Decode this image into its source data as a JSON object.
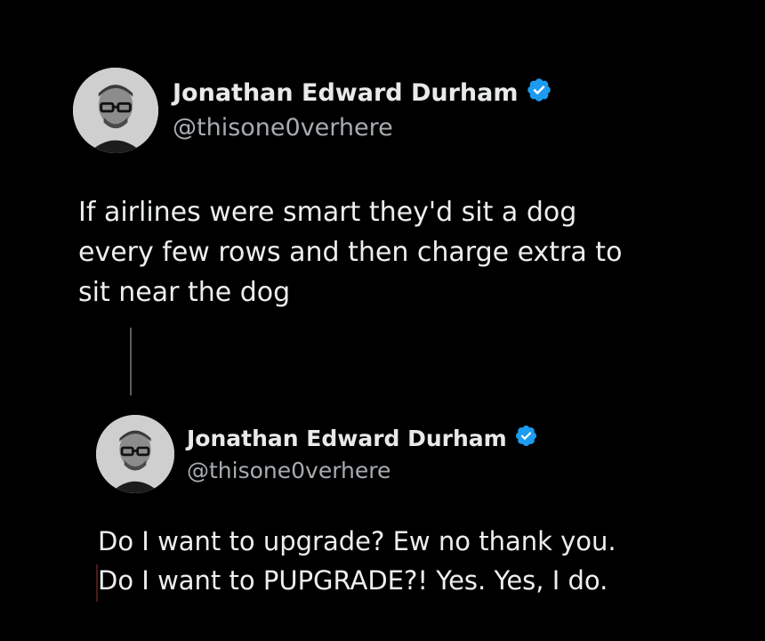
{
  "colors": {
    "background": "#000000",
    "text": "#e7e9ea",
    "handle": "#a7acb0",
    "verified_badge": "#1d9bf0",
    "thread_line": "#5a5e62"
  },
  "tweets": [
    {
      "author": {
        "display_name": "Jonathan Edward Durham",
        "handle": "@thisone0verhere",
        "verified": true,
        "avatar_icon": "profile-photo"
      },
      "text": "If airlines were smart they'd sit a dog\nevery few rows and then charge extra to\nsit near the dog"
    },
    {
      "author": {
        "display_name": "Jonathan Edward Durham",
        "handle": "@thisone0verhere",
        "verified": true,
        "avatar_icon": "profile-photo"
      },
      "text": "Do I want to upgrade? Ew no thank you.\nDo I want to PUPGRADE?! Yes. Yes, I do."
    }
  ]
}
